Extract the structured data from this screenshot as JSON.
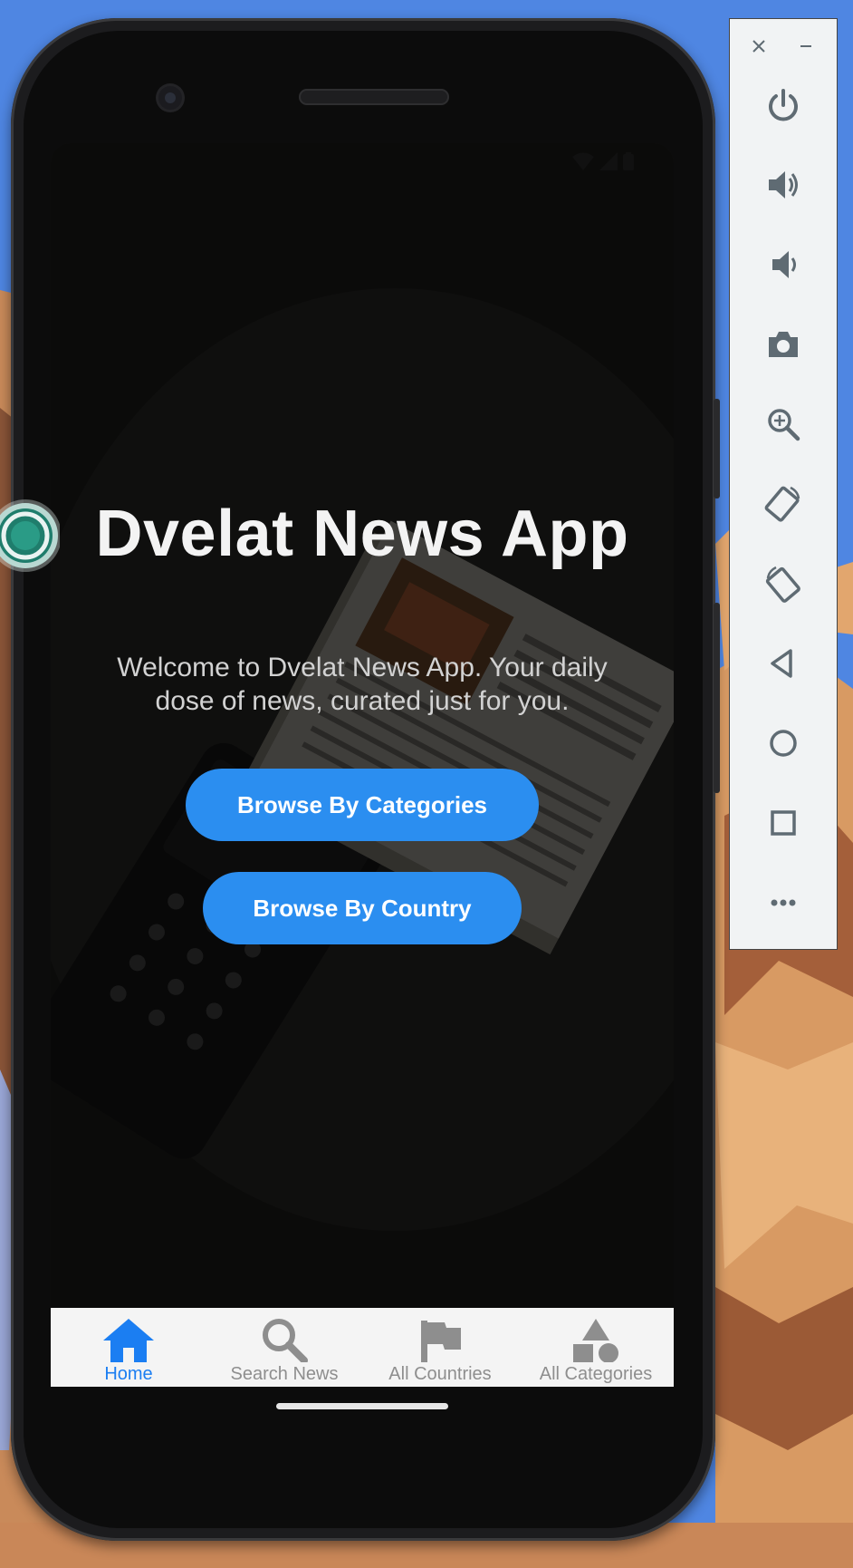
{
  "app": {
    "title": "Dvelat News App",
    "subtitle": "Welcome to Dvelat News App. Your daily dose of news, curated just for you.",
    "buttons": {
      "categories": "Browse By Categories",
      "country": "Browse By Country"
    }
  },
  "bottom_nav": {
    "items": [
      {
        "label": "Home",
        "icon": "home-icon",
        "active": true
      },
      {
        "label": "Search News",
        "icon": "search-icon",
        "active": false
      },
      {
        "label": "All Countries",
        "icon": "flag-icon",
        "active": false
      },
      {
        "label": "All Categories",
        "icon": "shapes-icon",
        "active": false
      }
    ]
  },
  "emulator_panel": {
    "controls": [
      "close-icon",
      "minimize-icon",
      "power-icon",
      "volume-up-icon",
      "volume-down-icon",
      "camera-icon",
      "zoom-icon",
      "rotate-left-icon",
      "rotate-right-icon",
      "back-icon",
      "home-circle-icon",
      "overview-icon",
      "more-icon"
    ]
  },
  "colors": {
    "accent": "#2b8ef0",
    "nav_active": "#1b7ef2",
    "nav_inactive": "#8e8e8e",
    "panel_icon": "#5f6b73"
  }
}
